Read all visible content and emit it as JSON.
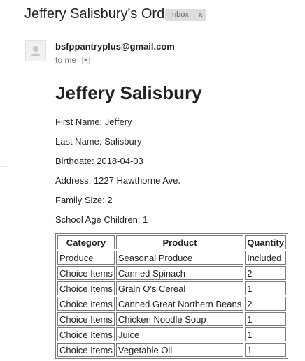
{
  "subject": {
    "title": "Jeffery Salisbury's Order",
    "label_chip": "Inbox",
    "label_remove": "x"
  },
  "sender": {
    "email": "bsfppantryplus@gmail.com",
    "recipient": "to me"
  },
  "message": {
    "heading": "Jeffery Salisbury",
    "fields": [
      "First Name: Jeffery",
      "Last Name: Salisbury",
      "Birthdate: 2018-04-03",
      "Address: 1227 Hawthorne Ave.",
      "Family Size: 2",
      "School Age Children: 1"
    ]
  },
  "order_table": {
    "headers": [
      "Category",
      "Product",
      "Quantity"
    ],
    "rows": [
      [
        "Produce",
        "Seasonal Produce",
        "Included"
      ],
      [
        "Choice Items",
        "Canned Spinach",
        "2"
      ],
      [
        "Choice Items",
        "Grain O's Cereal",
        "1"
      ],
      [
        "Choice Items",
        "Canned Great Northern Beans",
        "2"
      ],
      [
        "Choice Items",
        "Chicken Noodle Soup",
        "1"
      ],
      [
        "Choice Items",
        "Juice",
        "1"
      ],
      [
        "Choice Items",
        "Vegetable Oil",
        "1"
      ]
    ]
  },
  "icons": {
    "avatar": "person-silhouette-icon",
    "recipient_toggle": "dropdown-arrow-icon"
  }
}
